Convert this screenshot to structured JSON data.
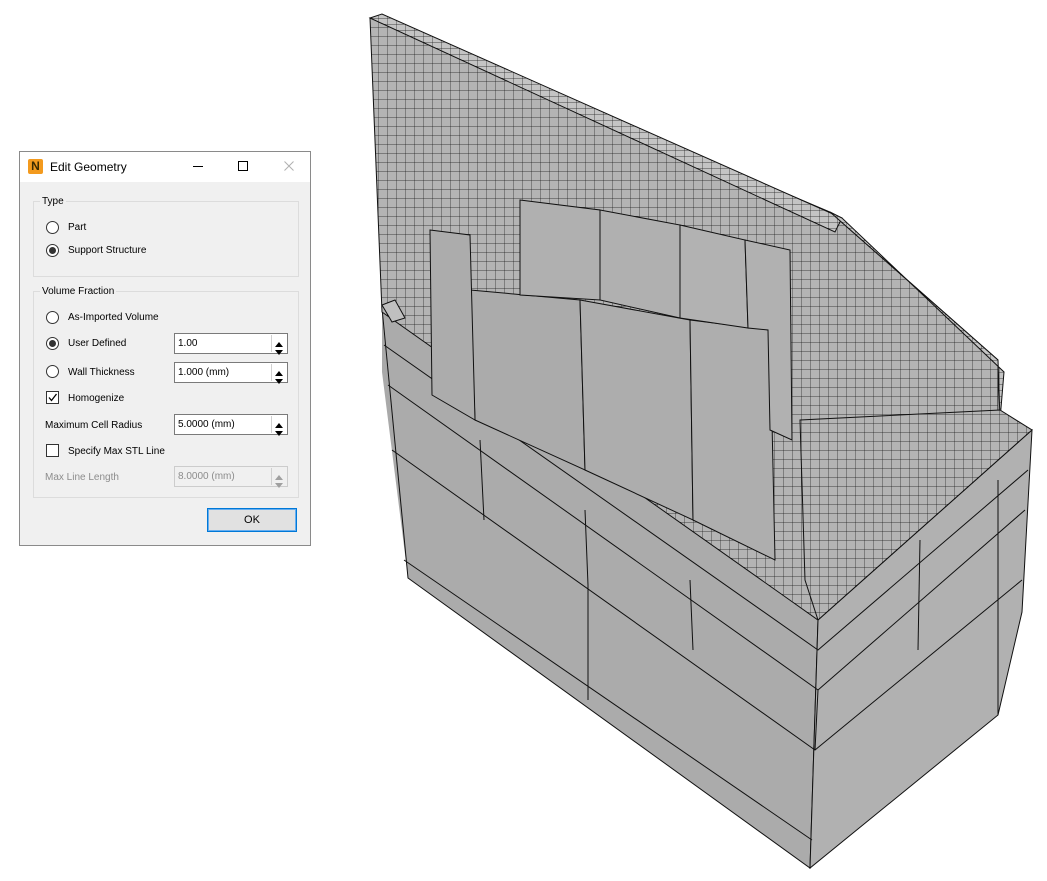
{
  "dialog": {
    "title": "Edit Geometry",
    "app_icon_letter": "N",
    "accent_color": "#0078d7",
    "type_group": {
      "legend": "Type",
      "options": [
        {
          "label": "Part",
          "selected": false
        },
        {
          "label": "Support Structure",
          "selected": true
        }
      ]
    },
    "volume_group": {
      "legend": "Volume Fraction",
      "as_imported": {
        "label": "As-Imported Volume",
        "selected": false
      },
      "user_defined": {
        "label": "User Defined",
        "selected": true,
        "value": "1.00"
      },
      "wall_thickness": {
        "label": "Wall Thickness",
        "selected": false,
        "value": "1.000 (mm)"
      },
      "homogenize": {
        "label": "Homogenize",
        "checked": true
      },
      "max_cell_radius": {
        "label": "Maximum Cell Radius",
        "value": "5.0000 (mm)"
      },
      "specify_max_stl": {
        "label": "Specify Max STL Line",
        "checked": false
      },
      "max_line_length": {
        "label": "Max Line Length",
        "value": "8.0000 (mm)",
        "enabled": false
      }
    },
    "ok_label": "OK"
  },
  "viewport": {
    "model": "voxel-mesh",
    "face_colors": {
      "top": "#b9b9b9",
      "left": "#a9a9a9",
      "right": "#b0b0b0",
      "edge": "#101010"
    }
  }
}
